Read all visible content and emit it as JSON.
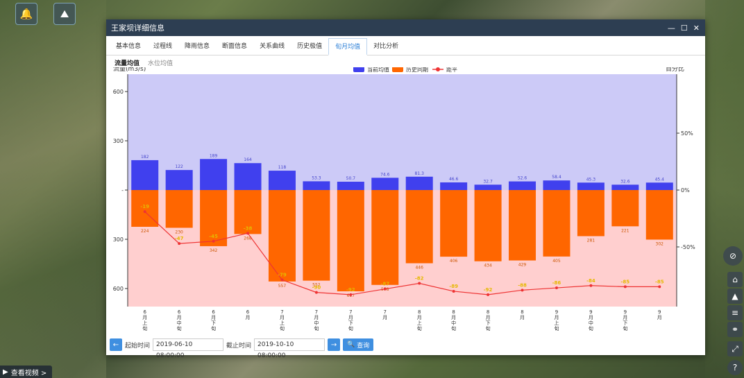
{
  "window": {
    "title": "王家坝详细信息"
  },
  "tabs": [
    "基本信息",
    "过程线",
    "降雨信息",
    "断面信息",
    "关系曲线",
    "历史极值",
    "旬月均值",
    "对比分析"
  ],
  "active_tab": 6,
  "subtabs": [
    "流量均值",
    "水位均值"
  ],
  "active_subtab": 0,
  "footer": {
    "start_label": "起始时间",
    "start_value": "2019-06-10 08:00:00",
    "end_label": "截止时间",
    "end_value": "2019-10-10 08:00:00",
    "query_label": "查询"
  },
  "overlay": {
    "video_label": "查看视频 >"
  },
  "colors": {
    "current": "#4040ee",
    "history": "#ff6600",
    "anomaly": "#ee3333",
    "upper_bg": "#cccaf7",
    "lower_bg": "#ffcfcf"
  },
  "chart_data": {
    "type": "bar",
    "ylabel_left": "流量(m3/s)",
    "ylabel_right": "百分比",
    "left_ticks": [
      "600",
      "300",
      "-",
      "300",
      "600"
    ],
    "right_ticks": [
      "50%",
      "0%",
      "-50%"
    ],
    "legend": [
      "当前均值",
      "历史同期",
      "距平"
    ],
    "categories": [
      "6月上旬",
      "6月中旬",
      "6月下旬",
      "6月",
      "7月上旬",
      "7月中旬",
      "7月下旬",
      "7月",
      "8月上旬",
      "8月中旬",
      "8月下旬",
      "8月",
      "9月上旬",
      "9月中旬",
      "9月下旬",
      "9月"
    ],
    "series": [
      {
        "name": "当前均值",
        "values": [
          "182",
          "122",
          "189",
          "164",
          "118",
          "53.3",
          "50.7",
          "74.6",
          "81.3",
          "46.6",
          "32.7",
          "52.6",
          "58.4",
          "45.3",
          "32.6",
          "45.4"
        ]
      },
      {
        "name": "历史同期",
        "values": [
          "224",
          "230",
          "342",
          "268",
          "557",
          "552",
          "617",
          "578",
          "446",
          "406",
          "434",
          "429",
          "405",
          "281",
          "221",
          "302"
        ]
      },
      {
        "name": "距平",
        "values": [
          "-19",
          "-47",
          "-45",
          "-38",
          "-79",
          "-90",
          "-92",
          "-87",
          "-82",
          "-89",
          "-92",
          "-88",
          "-86",
          "-84",
          "-85",
          "-85"
        ]
      }
    ],
    "ylim": [
      -700,
      700
    ],
    "y2lim": [
      -115,
      115
    ]
  }
}
